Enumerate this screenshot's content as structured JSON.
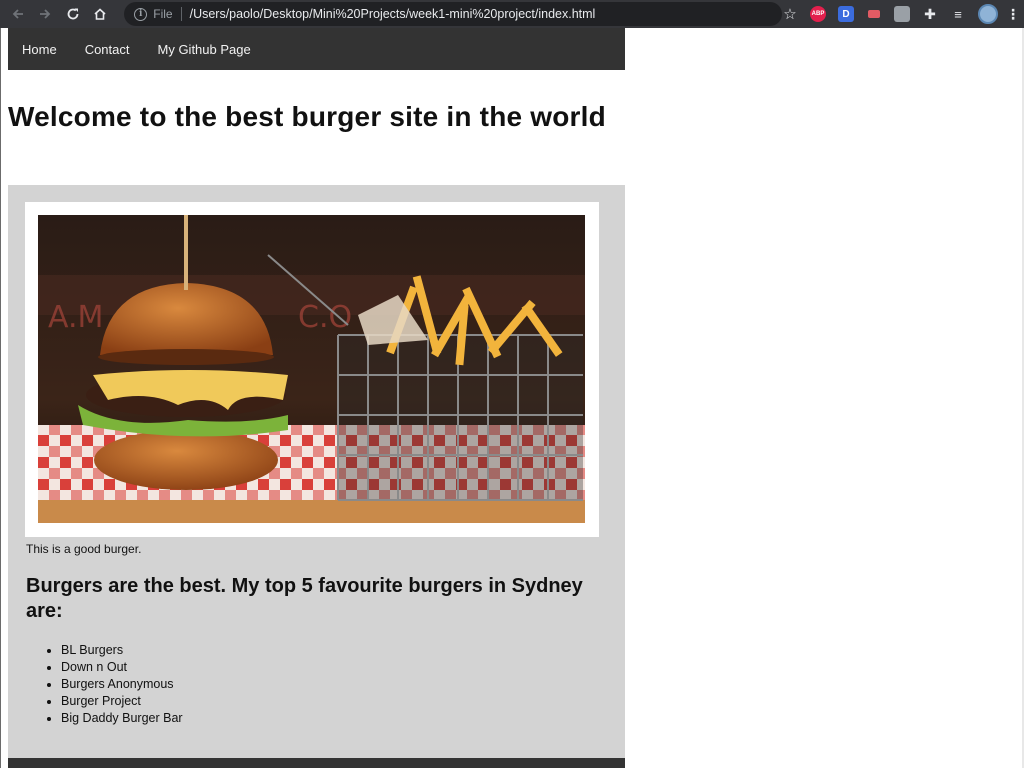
{
  "browser": {
    "address_scheme": "File",
    "url": "/Users/paolo/Desktop/Mini%20Projects/week1-mini%20project/index.html",
    "extensions": [
      "ABP",
      "D"
    ]
  },
  "nav": {
    "items": [
      {
        "label": "Home"
      },
      {
        "label": "Contact"
      },
      {
        "label": "My Github Page"
      }
    ]
  },
  "main": {
    "title": "Welcome to the best burger site in the world",
    "image_caption": "This is a good burger.",
    "subheading": "Burgers are the best. My top 5 favourite burgers in Sydney are:",
    "burgers": [
      "BL Burgers",
      "Down n Out",
      "Burgers Anonymous",
      "Burger Project",
      "Big Daddy Burger Bar"
    ]
  },
  "colors": {
    "navbar": "#333333",
    "content_bg": "#d3d3d3",
    "chrome": "#35363a"
  }
}
